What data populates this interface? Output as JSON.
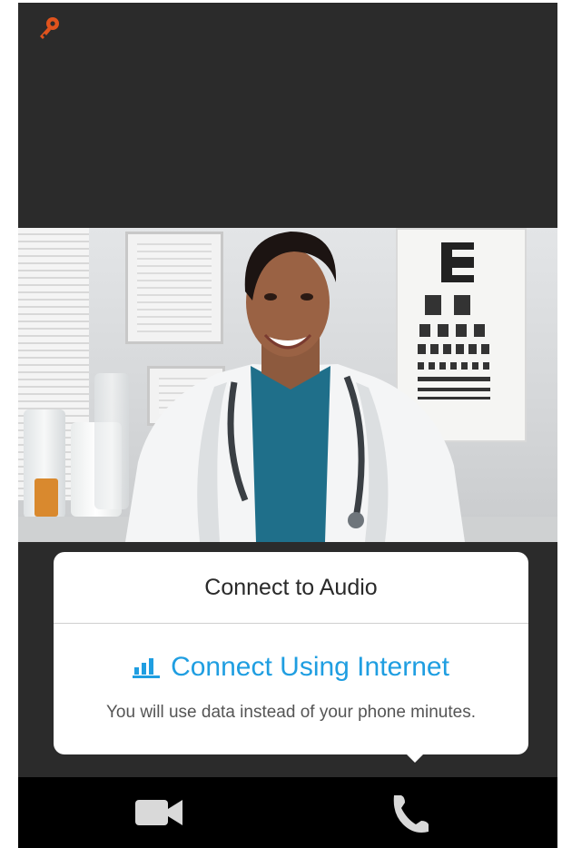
{
  "top": {
    "key_icon": "key-icon",
    "key_color": "#e0531d"
  },
  "video": {
    "description_icon": "video-feed"
  },
  "popover": {
    "title": "Connect to Audio",
    "option_label": "Connect Using Internet",
    "option_icon": "signal-bars-icon",
    "description": "You will use data instead of your phone minutes.",
    "accent_color": "#1f9ee1"
  },
  "bottom_bar": {
    "video_icon": "video-camera-icon",
    "audio_icon": "phone-icon"
  }
}
